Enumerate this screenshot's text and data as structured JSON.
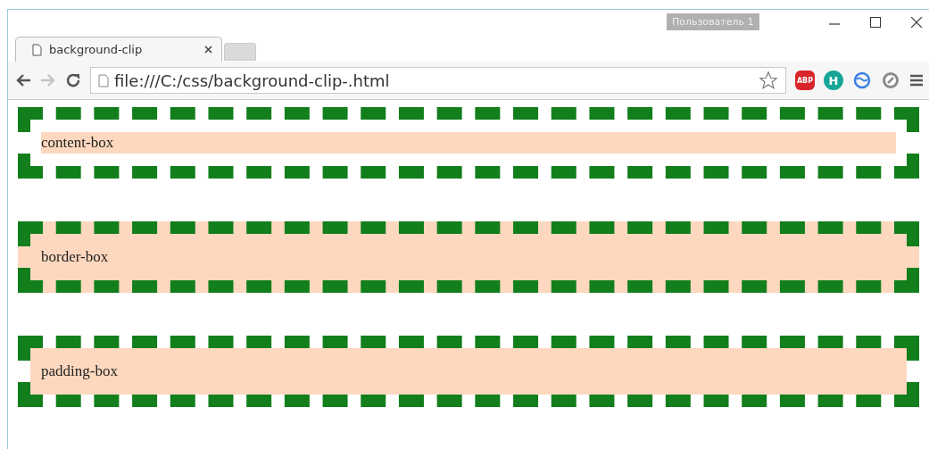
{
  "window": {
    "user_badge": "Пользователь 1"
  },
  "tabs": [
    {
      "title": "background-clip",
      "selected": true
    }
  ],
  "address_bar": {
    "url": "file:///C:/css/background-clip-.html"
  },
  "extensions": [
    {
      "kind": "abp",
      "label": "ABP"
    },
    {
      "kind": "letter",
      "label": "H"
    },
    {
      "kind": "sync"
    },
    {
      "kind": "compass"
    }
  ],
  "boxes": [
    {
      "label": "content-box",
      "kind": "content"
    },
    {
      "label": "border-box",
      "kind": "border"
    },
    {
      "label": "padding-box",
      "kind": "padding"
    }
  ]
}
